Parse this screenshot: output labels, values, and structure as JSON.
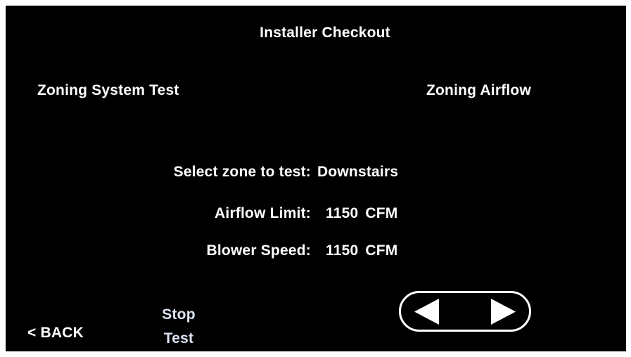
{
  "header": {
    "title": "Installer Checkout"
  },
  "sections": {
    "left_heading": "Zoning System Test",
    "right_heading": "Zoning Airflow"
  },
  "fields": [
    {
      "label": "Select zone to test:",
      "value": "Downstairs",
      "unit": ""
    },
    {
      "label": "Airflow Limit:",
      "value": "1150",
      "unit": "CFM"
    },
    {
      "label": "Blower Speed:",
      "value": "1150",
      "unit": "CFM"
    }
  ],
  "footer": {
    "back_label": "< BACK",
    "stop_label_line1": "Stop",
    "stop_label_line2": "Test",
    "prev_icon": "triangle-left-icon",
    "next_icon": "triangle-right-icon"
  },
  "colors": {
    "background": "#000000",
    "text": "#ffffff",
    "stop_text": "#dde4f4"
  }
}
